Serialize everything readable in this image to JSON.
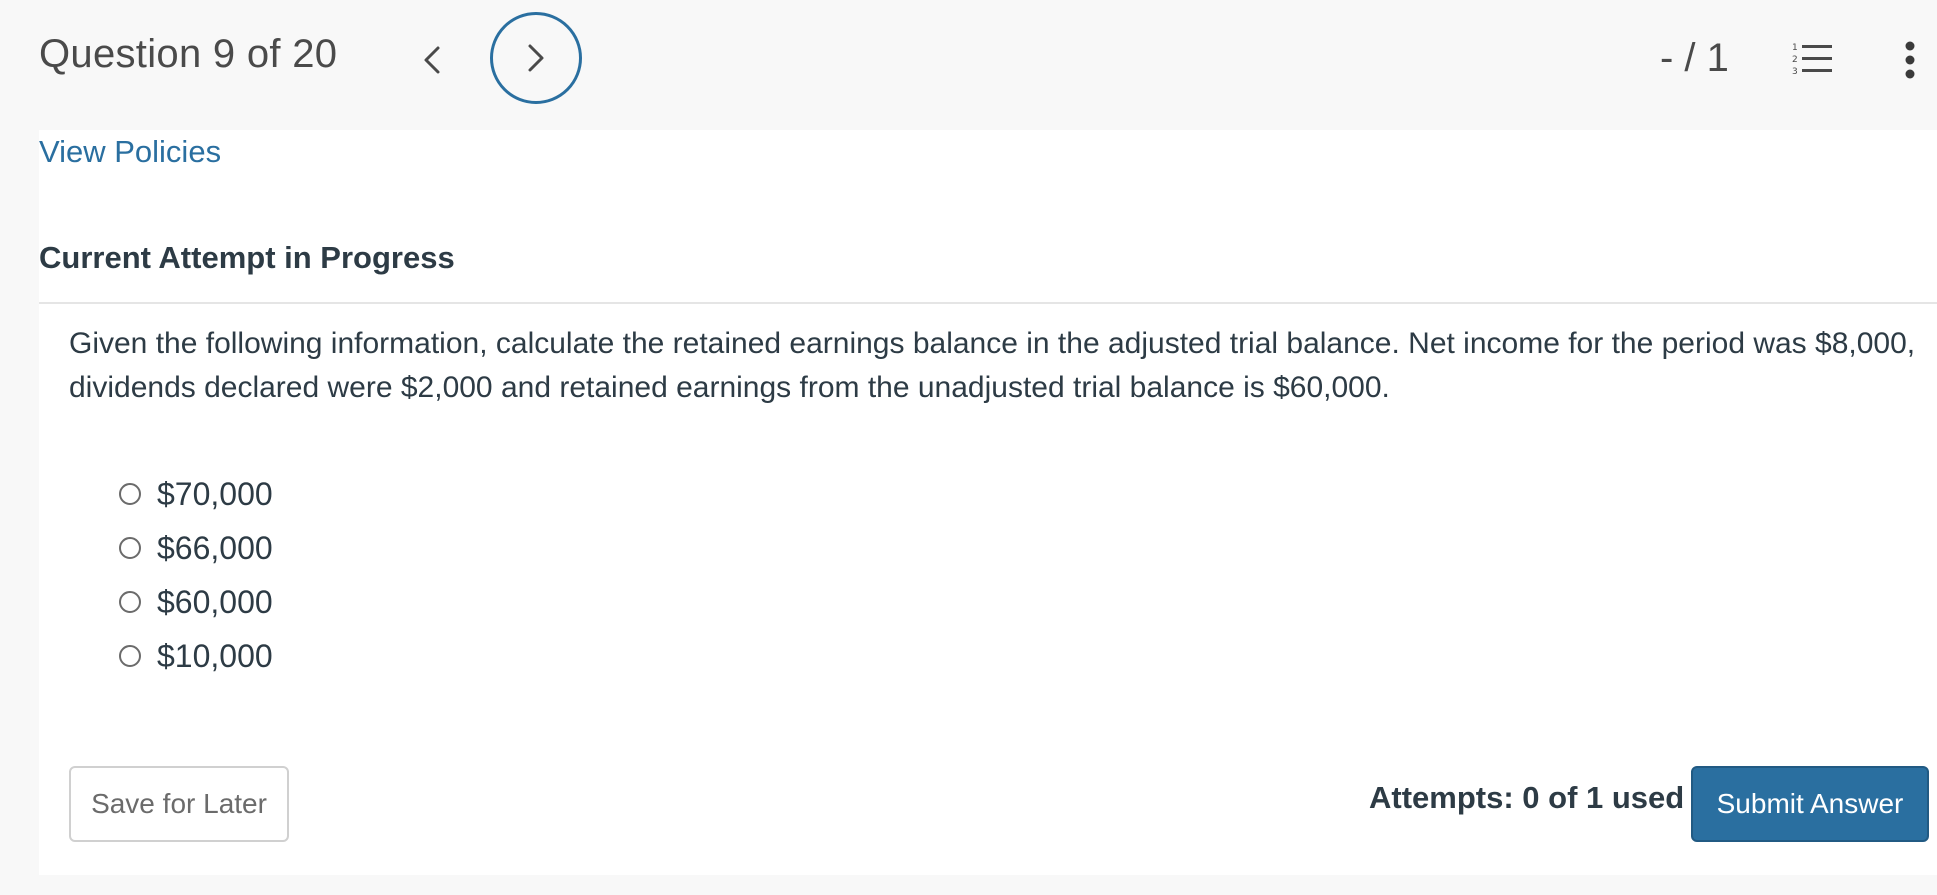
{
  "header": {
    "question_title": "Question 9 of 20",
    "score": "- / 1",
    "prev_icon": "chevron-left-icon",
    "next_icon": "chevron-right-icon",
    "list_icon": "numbered-list-icon",
    "more_icon": "vertical-ellipsis-icon",
    "accent_color": "#2a6fa0"
  },
  "links": {
    "view_policies": "View Policies"
  },
  "attempt": {
    "heading": "Current Attempt in Progress"
  },
  "question": {
    "text": "Given the following information, calculate the retained earnings balance in the adjusted trial balance. Net income for the period was $8,000, dividends declared were $2,000 and retained earnings from the unadjusted trial balance is $60,000.",
    "options": [
      {
        "label": "$70,000"
      },
      {
        "label": "$66,000"
      },
      {
        "label": "$60,000"
      },
      {
        "label": "$10,000"
      }
    ]
  },
  "footer": {
    "save_label": "Save for Later",
    "attempts_text": "Attempts: 0 of 1 used",
    "submit_label": "Submit Answer"
  }
}
